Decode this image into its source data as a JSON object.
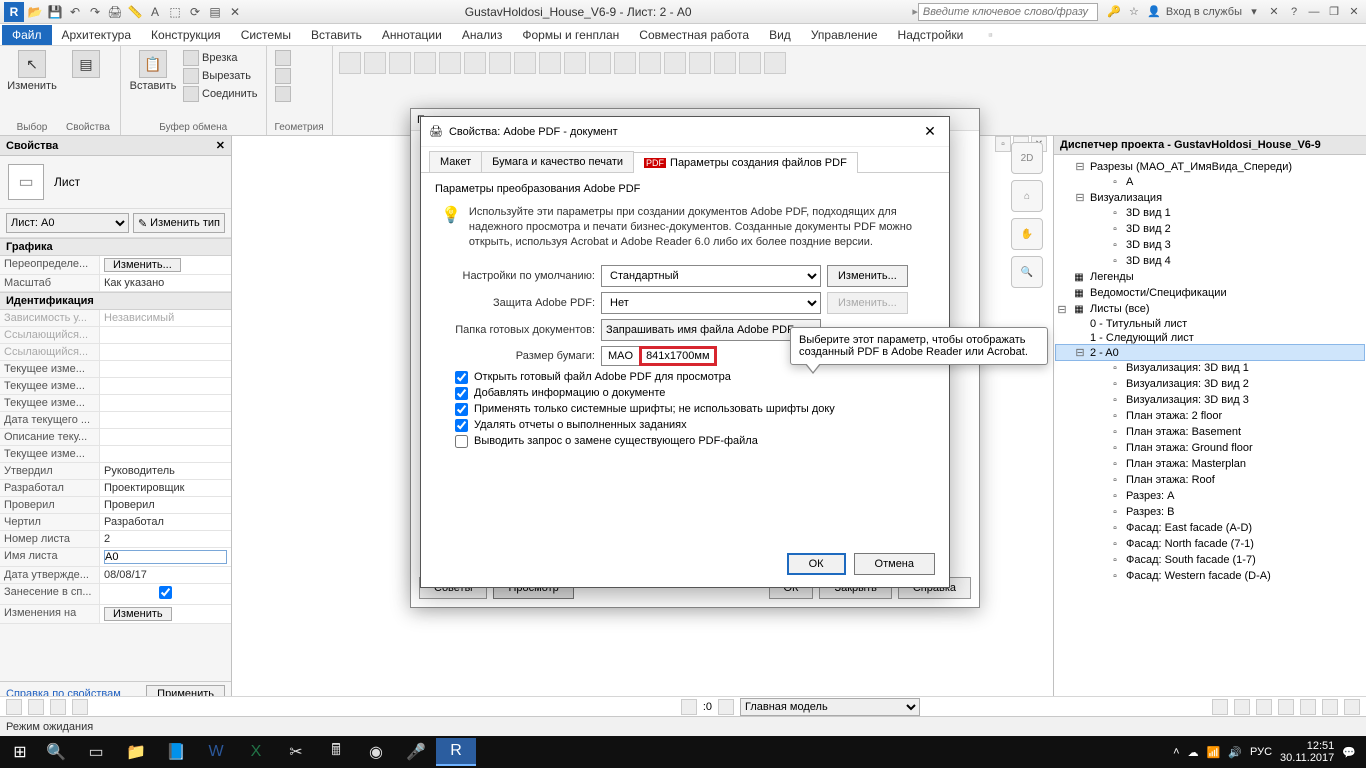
{
  "title": "GustavHoldosi_House_V6-9 - Лист: 2 - A0",
  "search_placeholder": "Введите ключевое слово/фразу",
  "login_label": "Вход в службы",
  "menu": {
    "file": "Файл",
    "items": [
      "Архитектура",
      "Конструкция",
      "Системы",
      "Вставить",
      "Аннотации",
      "Анализ",
      "Формы и генплан",
      "Совместная работа",
      "Вид",
      "Управление",
      "Надстройки"
    ]
  },
  "ribbon": {
    "change": "Изменить",
    "select": "Выбор",
    "props": "Свойства",
    "paste": "Вставить",
    "cut": "Врезка",
    "cutout": "Вырезать",
    "join": "Соединить",
    "clipboard": "Буфер обмена",
    "geometry": "Геометрия"
  },
  "props": {
    "title": "Свойства",
    "type": "Лист",
    "selector": "Лист: A0",
    "edit_type": "Изменить тип",
    "group_graphics": "Графика",
    "group_identity": "Идентификация",
    "rows": [
      {
        "k": "Переопределе...",
        "v": "Изменить...",
        "btn": true
      },
      {
        "k": "Масштаб",
        "v": "Как указано"
      },
      {
        "k": "Зависимость у...",
        "v": "Независимый",
        "gray": true
      },
      {
        "k": "Ссылающийся...",
        "v": "",
        "gray": true
      },
      {
        "k": "Ссылающийся...",
        "v": "",
        "gray": true
      },
      {
        "k": "Текущее изме...",
        "v": ""
      },
      {
        "k": "Текущее изме...",
        "v": ""
      },
      {
        "k": "Текущее изме...",
        "v": ""
      },
      {
        "k": "Дата текущего ...",
        "v": ""
      },
      {
        "k": "Описание теку...",
        "v": ""
      },
      {
        "k": "Текущее изме...",
        "v": ""
      },
      {
        "k": "Утвердил",
        "v": "Руководитель"
      },
      {
        "k": "Разработал",
        "v": "Проектировщик"
      },
      {
        "k": "Проверил",
        "v": "Проверил"
      },
      {
        "k": "Чертил",
        "v": "Разработал"
      },
      {
        "k": "Номер листа",
        "v": "2"
      },
      {
        "k": "Имя листа",
        "v": "A0",
        "edit": true
      },
      {
        "k": "Дата утвержде...",
        "v": "08/08/17"
      },
      {
        "k": "Занесение в сп...",
        "v": "",
        "check": true
      },
      {
        "k": "Изменения на",
        "v": "Изменить",
        "btn": true
      }
    ],
    "help_link": "Справка по свойствам",
    "apply": "Применить"
  },
  "browser": {
    "title": "Диспетчер проекта - GustavHoldosi_House_V6-9",
    "sections_header": "Разрезы (MAO_AT_ИмяВида_Спереди)",
    "a": "A",
    "viz": "Визуализация",
    "views3d": [
      "3D вид 1",
      "3D вид 2",
      "3D вид 3",
      "3D вид 4"
    ],
    "legends": "Легенды",
    "schedules": "Ведомости/Спецификации",
    "sheets": "Листы (все)",
    "sheet_items": [
      "0 - Титульный лист",
      "1 - Следующий лист"
    ],
    "sheet_active": "2 - A0",
    "sheet_children": [
      "Визуализация: 3D вид 1",
      "Визуализация: 3D вид 2",
      "Визуализация: 3D вид 3",
      "План этажа: 2 floor",
      "План этажа: Basement",
      "План этажа: Ground floor",
      "План этажа: Masterplan",
      "План этажа: Roof",
      "Разрез: A",
      "Разрез: B",
      "Фасад: East facade (A-D)",
      "Фасад: North facade (7-1)",
      "Фасад: South facade (1-7)",
      "Фасад: Western facade (D-A)"
    ]
  },
  "print_dlg": {
    "title": "Печать",
    "hint": "Советы",
    "preview": "Просмотр",
    "ok": "ОК",
    "close": "Закрыть",
    "help": "Справка"
  },
  "pdf_dlg": {
    "title": "Свойства: Adobe PDF - документ",
    "tab1": "Макет",
    "tab2": "Бумага и качество печати",
    "tab3": "Параметры создания файлов PDF",
    "group": "Параметры преобразования Adobe PDF",
    "hint": "Используйте эти параметры при создании документов Adobe PDF, подходящих для надежного просмотра и печати бизнес-документов. Созданные документы PDF можно открыть, используя Acrobat и Adobe Reader 6.0 либо их более поздние версии.",
    "l_default": "Настройки по умолчанию:",
    "v_default": "Стандартный",
    "change": "Изменить...",
    "l_security": "Защита Adobe PDF:",
    "v_security": "Нет",
    "l_folder": "Папка готовых документов:",
    "v_folder": "Запрашивать имя файла Adobe PDF",
    "l_size": "Размер бумаги:",
    "size_a": "MAO",
    "size_b": "841x1700мм",
    "chk1": "Открыть готовый файл Adobe PDF для просмотра",
    "chk2": "Добавлять информацию о документе",
    "chk3": "Применять только системные шрифты; не использовать шрифты доку",
    "chk4": "Удалять отчеты о выполненных заданиях",
    "chk5": "Выводить запрос о замене существующего PDF-файла",
    "ok": "ОК",
    "cancel": "Отмена"
  },
  "tooltip": "Выберите этот параметр, чтобы отображать созданный PDF в Adobe Reader или Acrobat.",
  "status": {
    "mode": "Режим ожидания",
    "main_model": "Главная модель",
    "zero": ":0"
  },
  "taskbar": {
    "time": "12:51",
    "date": "30.11.2017",
    "lang": "РУС"
  }
}
